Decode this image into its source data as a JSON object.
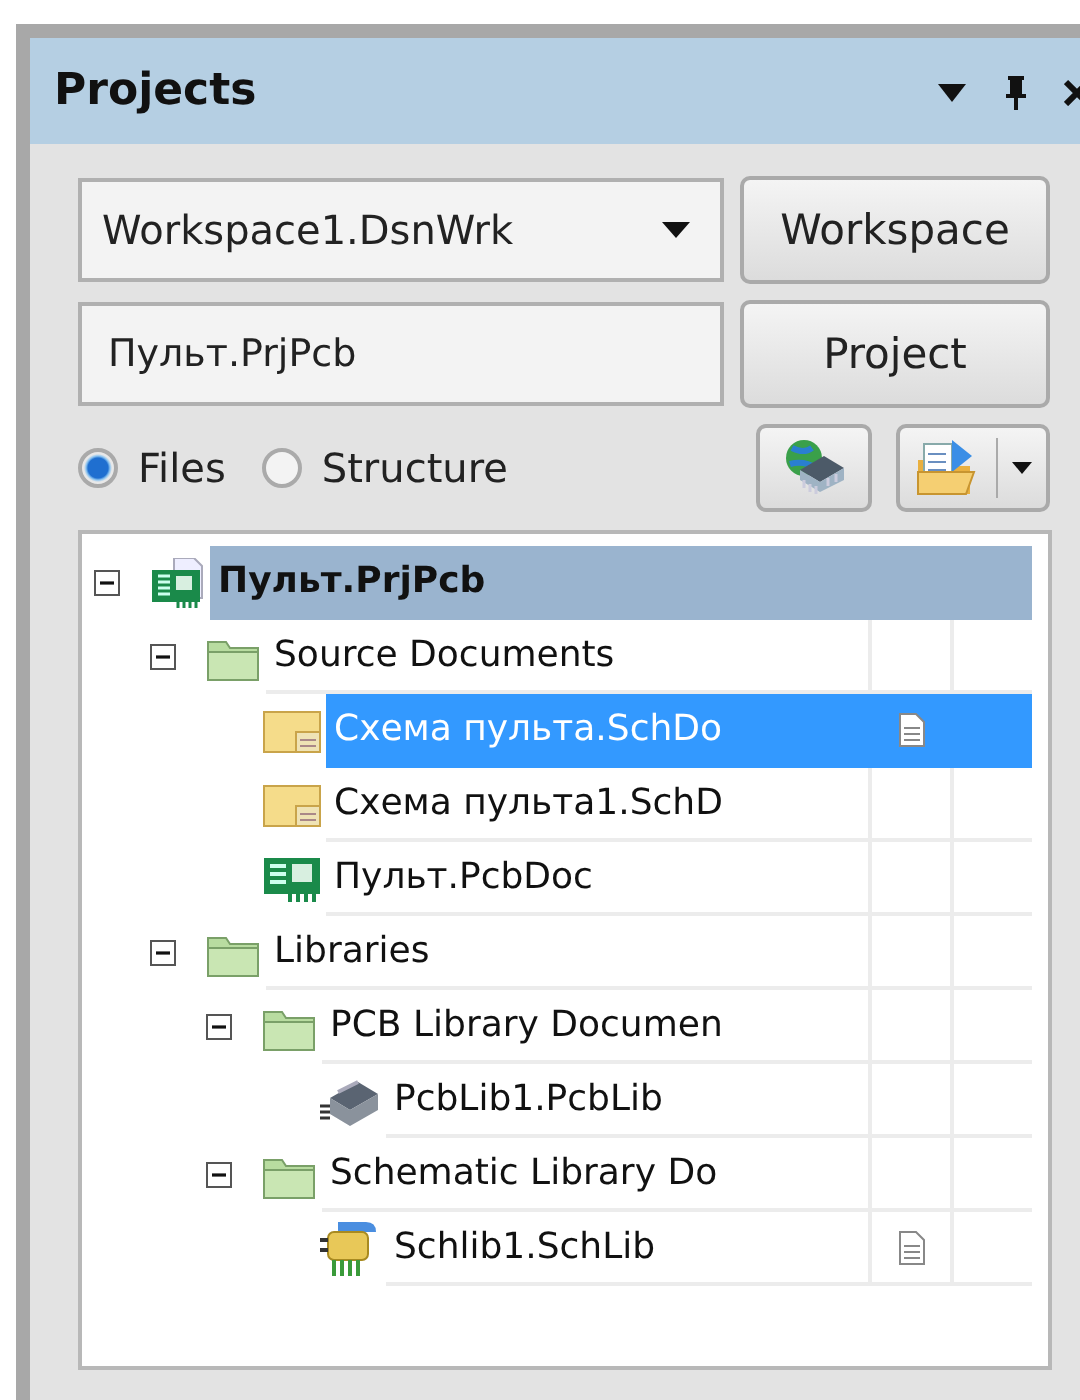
{
  "panel": {
    "title": "Projects"
  },
  "workspace": {
    "value": "Workspace1.DsnWrk",
    "button": "Workspace"
  },
  "project": {
    "value": "Пульт.PrjPcb",
    "button": "Project"
  },
  "view_options": [
    {
      "label": "Files",
      "selected": true
    },
    {
      "label": "Structure",
      "selected": false
    }
  ],
  "tree": [
    {
      "kind": "project",
      "label": "Пульт.PrjPcb",
      "active": true,
      "selected": false,
      "expanded": true,
      "children": [
        {
          "kind": "folder",
          "label": "Source Documents",
          "active": false,
          "selected": false,
          "expanded": true,
          "children": [
            {
              "kind": "schdoc",
              "label": "Схема пульта.SchDo",
              "active": false,
              "selected": true,
              "modified": true
            },
            {
              "kind": "schdoc",
              "label": "Схема пульта1.SchD",
              "active": false,
              "selected": false,
              "modified": false
            },
            {
              "kind": "pcbdoc",
              "label": "Пульт.PcbDoc",
              "active": false,
              "selected": false,
              "modified": false
            }
          ]
        },
        {
          "kind": "folder",
          "label": "Libraries",
          "active": false,
          "selected": false,
          "expanded": true,
          "children": [
            {
              "kind": "folder",
              "label": "PCB Library Documen",
              "active": false,
              "selected": false,
              "expanded": true,
              "children": [
                {
                  "kind": "pcblib",
                  "label": "PcbLib1.PcbLib",
                  "active": false,
                  "selected": false,
                  "modified": false
                }
              ]
            },
            {
              "kind": "folder",
              "label": "Schematic Library Do",
              "active": false,
              "selected": false,
              "expanded": true,
              "children": [
                {
                  "kind": "schlib",
                  "label": "Schlib1.SchLib",
                  "active": false,
                  "selected": false,
                  "modified": true
                }
              ]
            }
          ]
        }
      ]
    }
  ]
}
